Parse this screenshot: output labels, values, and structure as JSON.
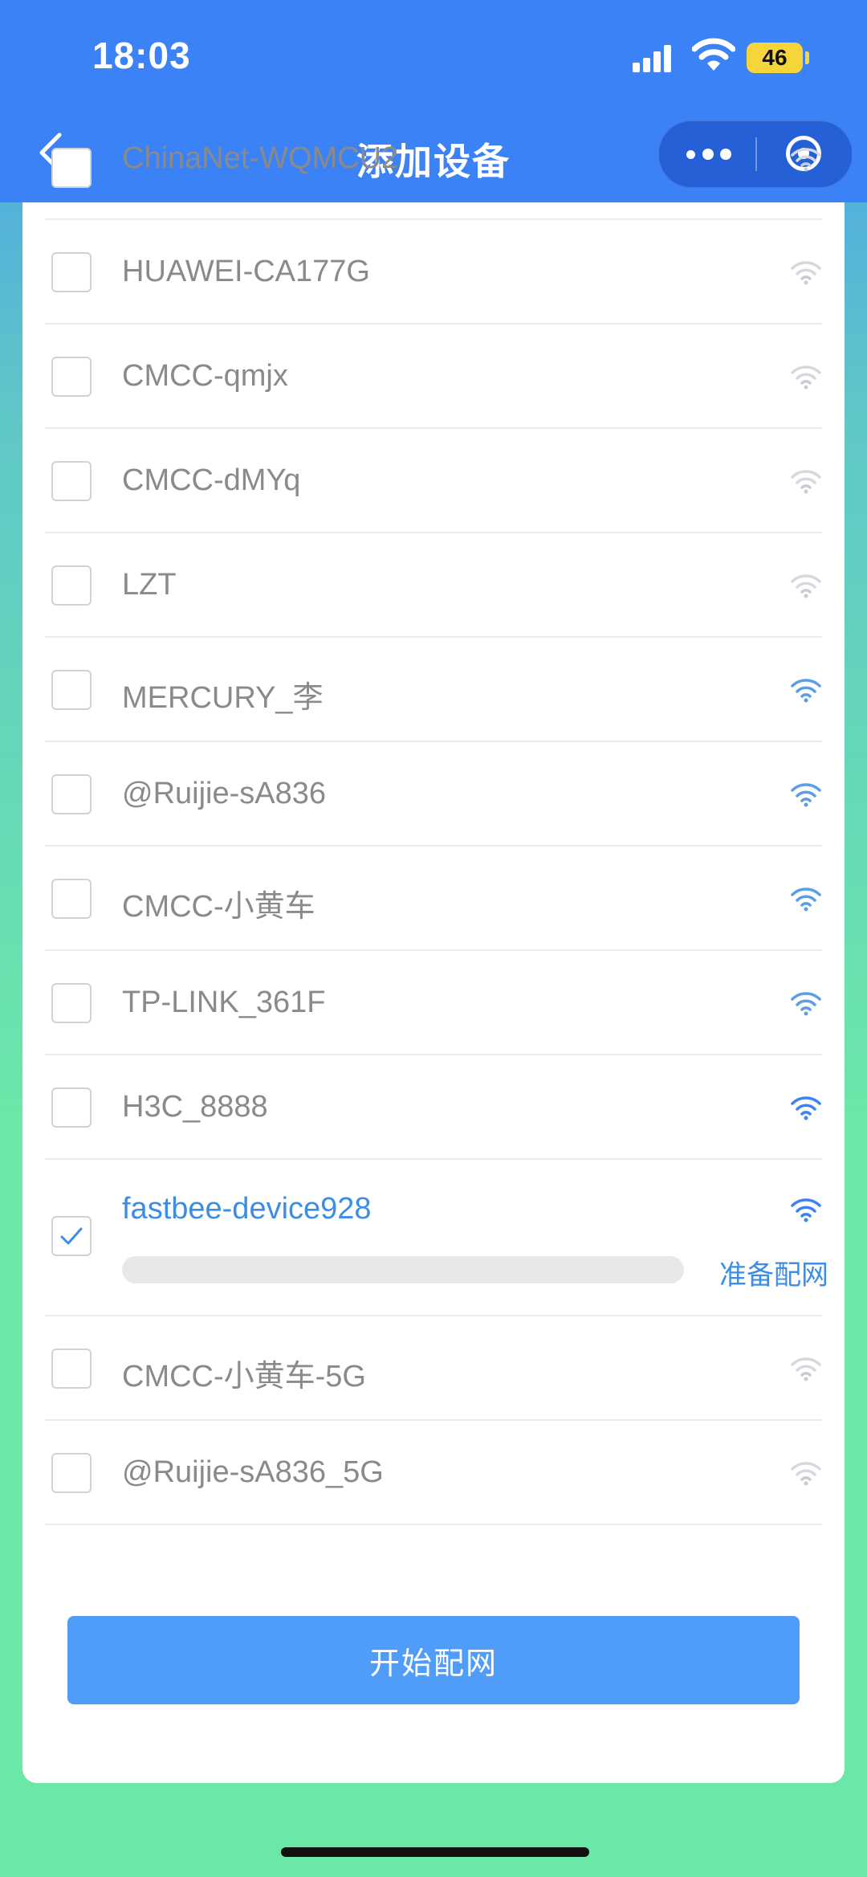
{
  "status_bar": {
    "time": "18:03",
    "battery": "46",
    "signal_icon": "cellular-signal-icon",
    "wifi_icon": "wifi-icon"
  },
  "nav": {
    "title": "添加设备",
    "back_icon": "chevron-left-icon",
    "more_icon": "more-dots-icon",
    "close_icon": "target-circle-icon"
  },
  "networks": [
    {
      "ssid": "ChinaNet-WQMCU2",
      "checked": false,
      "signal": "weak"
    },
    {
      "ssid": "HUAWEI-CA177G",
      "checked": false,
      "signal": "weak"
    },
    {
      "ssid": "CMCC-qmjx",
      "checked": false,
      "signal": "weak"
    },
    {
      "ssid": "CMCC-dMYq",
      "checked": false,
      "signal": "weak"
    },
    {
      "ssid": "LZT",
      "checked": false,
      "signal": "weak"
    },
    {
      "ssid": "MERCURY_李",
      "checked": false,
      "signal": "medium"
    },
    {
      "ssid": "@Ruijie-sA836",
      "checked": false,
      "signal": "medium"
    },
    {
      "ssid": "CMCC-小黄车",
      "checked": false,
      "signal": "medium"
    },
    {
      "ssid": "TP-LINK_361F",
      "checked": false,
      "signal": "medium"
    },
    {
      "ssid": "H3C_8888",
      "checked": false,
      "signal": "strong"
    },
    {
      "ssid": "fastbee-device928",
      "checked": true,
      "signal": "strong",
      "progress": 0,
      "progress_status": "准备配网"
    },
    {
      "ssid": "CMCC-小黄车-5G",
      "checked": false,
      "signal": "weak"
    },
    {
      "ssid": "@Ruijie-sA836_5G",
      "checked": false,
      "signal": "weak"
    }
  ],
  "start_button": "开始配网",
  "colors": {
    "accent": "#3b82f6",
    "active_text": "#3b8de6",
    "button": "#4f9cf9"
  }
}
